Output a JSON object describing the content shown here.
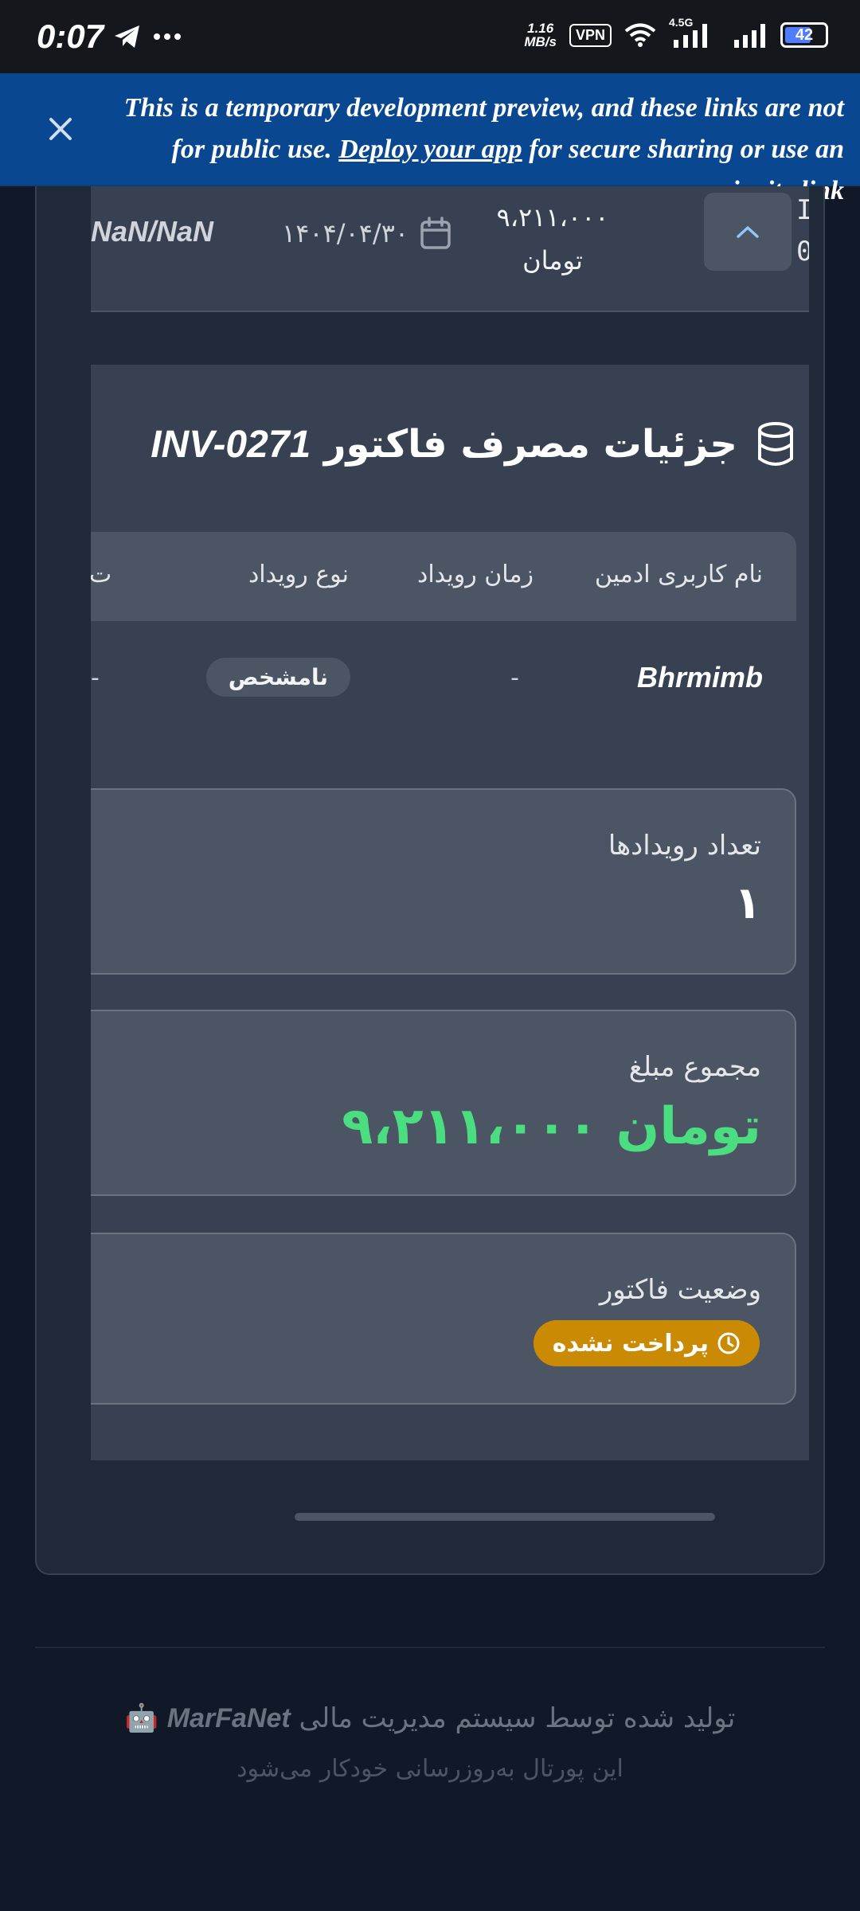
{
  "status_bar": {
    "time": "0:07",
    "net_speed_value": "1.16",
    "net_speed_unit": "MB/s",
    "vpn": "VPN",
    "network_type": "4.5G",
    "battery": "42"
  },
  "banner": {
    "text_before": "This is a temporary development preview, and these links are not for public use. ",
    "link_text": "Deploy your app",
    "text_after": " for secure sharing or use an invite link"
  },
  "invoice_row": {
    "nan_value": "NaN/NaN",
    "date": "۱۴۰۴/۰۴/۳۰",
    "amount_number": "۹،۲۱۱،۰۰۰",
    "amount_unit": "تومان",
    "edge_line1": "I",
    "edge_line2": "0"
  },
  "details": {
    "title_text": "جزئیات مصرف فاکتور",
    "title_code": "INV-0271",
    "table": {
      "headers": [
        "نام کاربری ادمین",
        "زمان رویداد",
        "نوع رویداد",
        "ت"
      ],
      "rows": [
        {
          "username": "Bhrmimb",
          "time": "-",
          "type": "نامشخص",
          "extra": "-"
        }
      ]
    },
    "stats": [
      {
        "label": "تعداد رویدادها",
        "value": "۱"
      },
      {
        "label": "مجموع مبلغ",
        "value": "۹،۲۱۱،۰۰۰ تومان"
      },
      {
        "label": "وضعیت فاکتور",
        "value": "پرداخت نشده"
      }
    ]
  },
  "footer": {
    "line1_text": "تولید شده توسط سیستم مدیریت مالی",
    "brand": "MarFaNet",
    "emoji": "🤖",
    "line2": "این پورتال به‌روزرسانی خودکار می‌شود"
  },
  "colors": {
    "background": "#111827",
    "card": "#1f2937",
    "panel": "#374151",
    "accent_green": "#4ade80",
    "status_unpaid": "#ca8a04",
    "banner": "#0a4791"
  }
}
